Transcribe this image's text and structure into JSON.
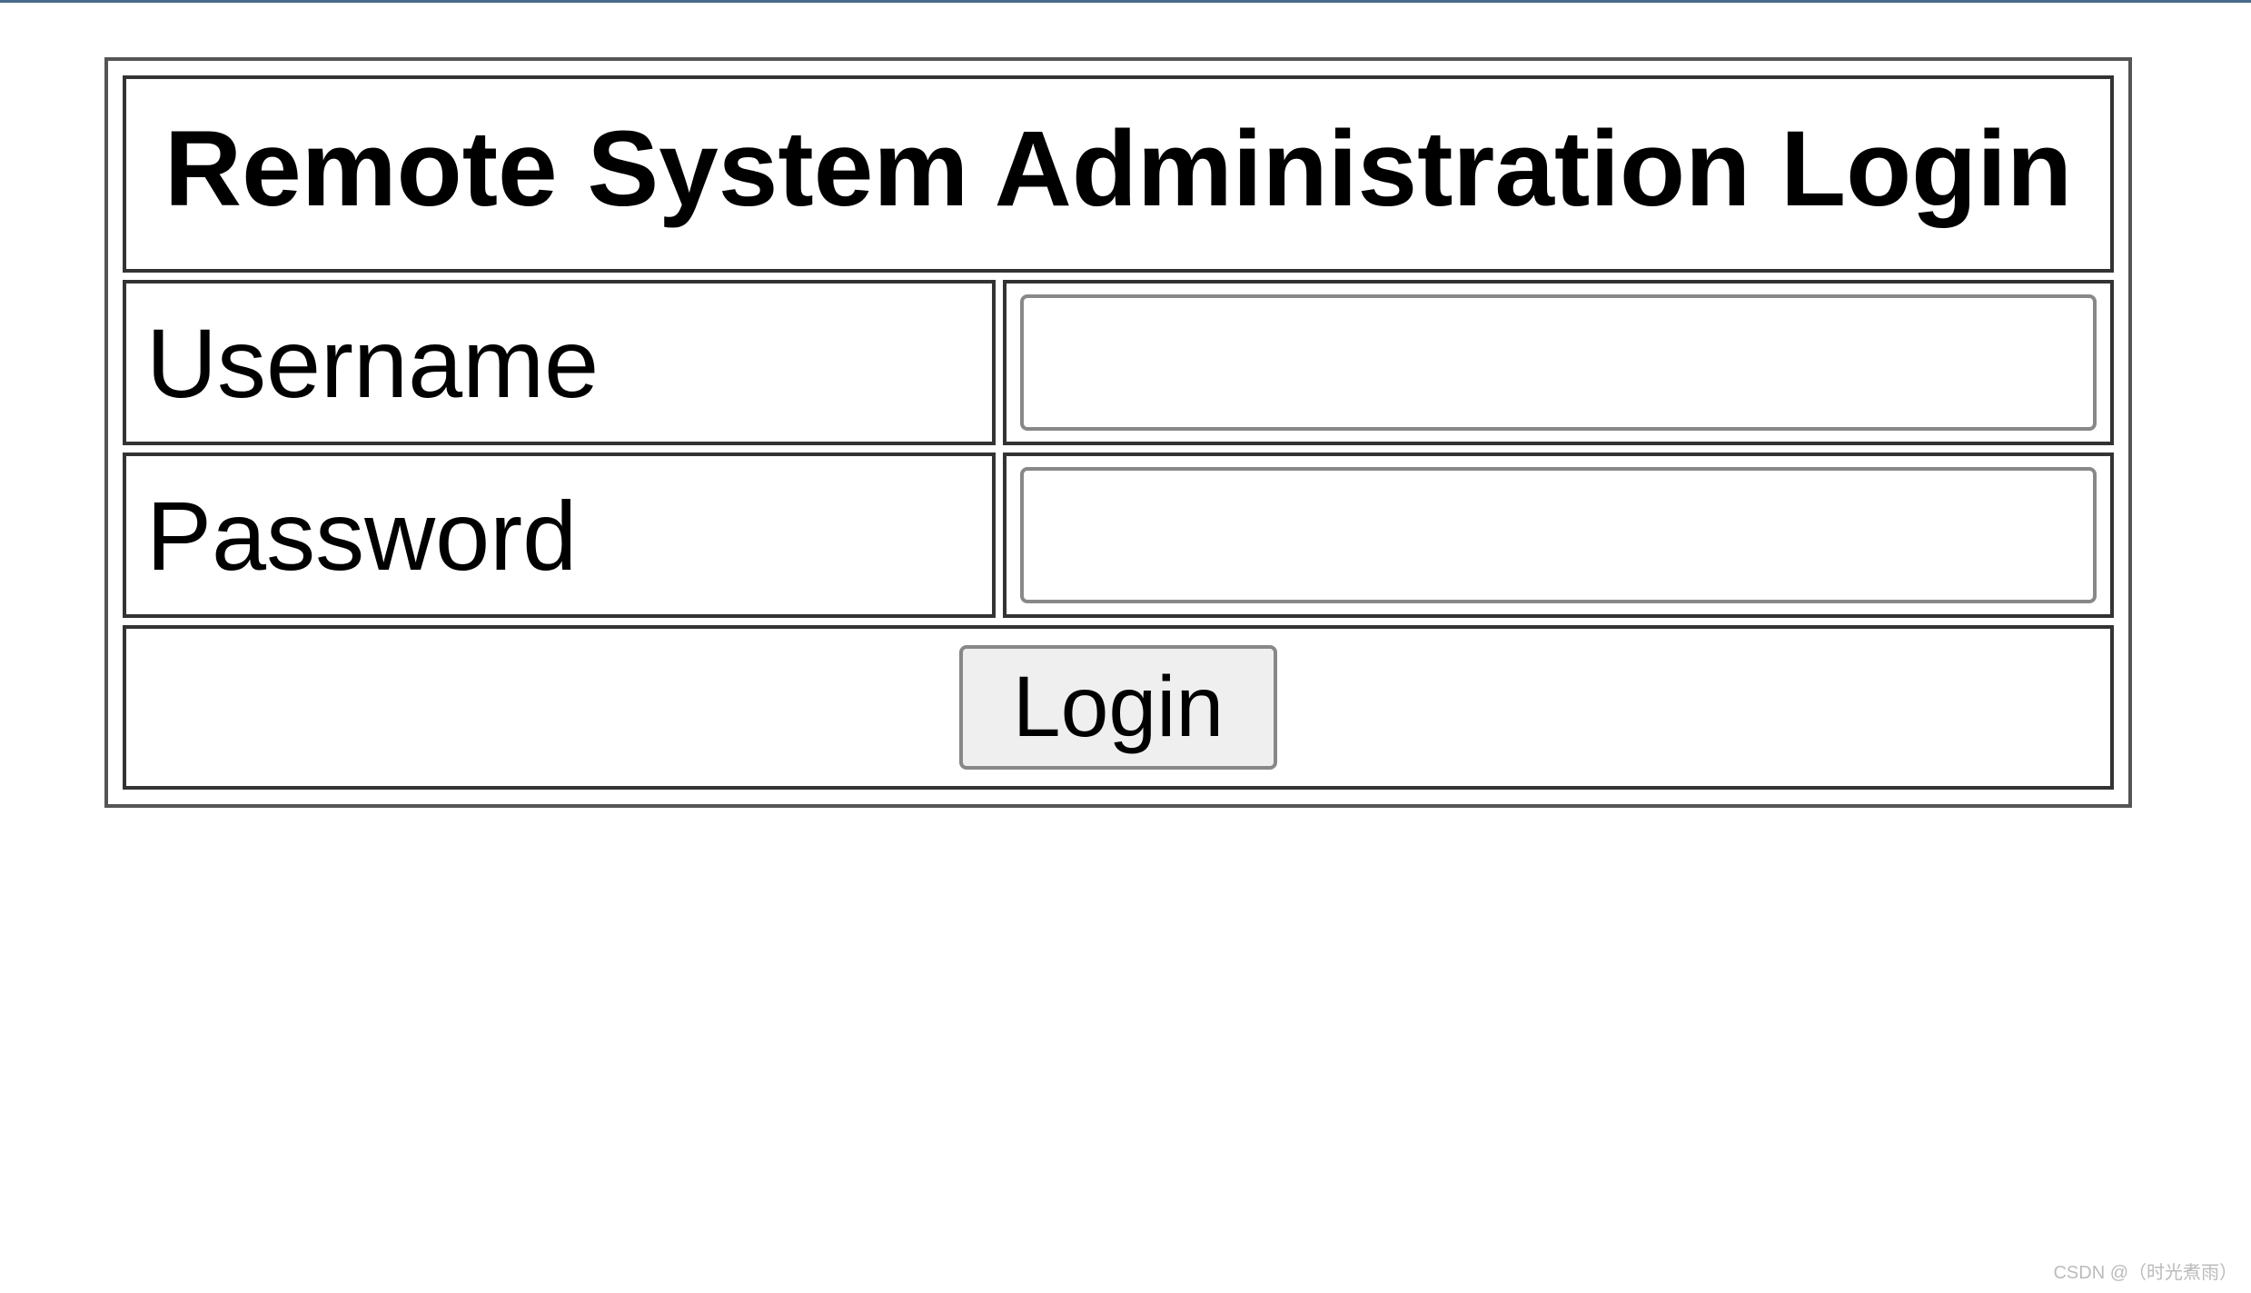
{
  "form": {
    "title": "Remote System Administration Login",
    "username_label": "Username",
    "username_value": "",
    "password_label": "Password",
    "password_value": "",
    "login_button_label": "Login"
  },
  "watermark": "CSDN @（时光煮雨）"
}
